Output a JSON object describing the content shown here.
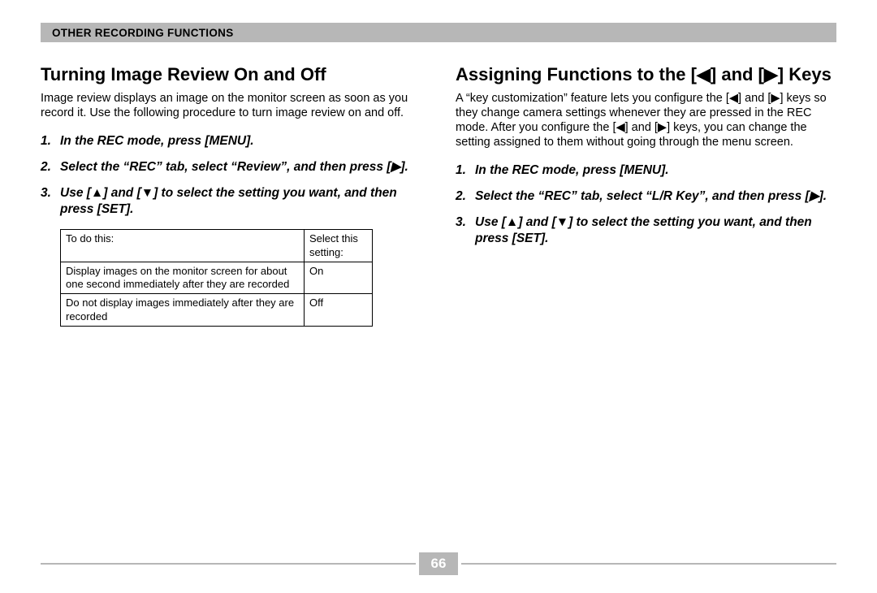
{
  "header": {
    "title": "Other Recording Functions"
  },
  "left": {
    "title": "Turning Image Review On and Off",
    "intro": "Image review displays an image on the monitor screen as soon as you record it. Use the following procedure to turn image review on and off.",
    "steps": [
      {
        "num": "1.",
        "text": "In the REC mode, press [MENU]."
      },
      {
        "num": "2.",
        "text": "Select the “REC” tab, select “Review”, and then press [▶]."
      },
      {
        "num": "3.",
        "text": "Use [▲] and [▼] to select the setting you want, and then press [SET]."
      }
    ],
    "table": {
      "headers": [
        "To do this:",
        "Select this setting:"
      ],
      "rows": [
        [
          "Display images on the monitor screen for about one second immediately after they are recorded",
          "On"
        ],
        [
          "Do not display images immediately after they are recorded",
          "Off"
        ]
      ]
    }
  },
  "right": {
    "title": "Assigning Functions to the [◀] and [▶] Keys",
    "intro": "A “key customization” feature lets you configure the [◀] and [▶] keys so they change camera settings whenever they are pressed in the REC mode. After you configure the [◀] and [▶] keys, you can change the setting assigned to them without going through the menu screen.",
    "steps": [
      {
        "num": "1.",
        "text": "In the REC mode, press [MENU]."
      },
      {
        "num": "2.",
        "text": "Select the “REC” tab, select “L/R Key”, and then press [▶]."
      },
      {
        "num": "3.",
        "text": "Use [▲] and [▼] to select the setting you want, and then press [SET]."
      }
    ]
  },
  "footer": {
    "page": "66"
  }
}
